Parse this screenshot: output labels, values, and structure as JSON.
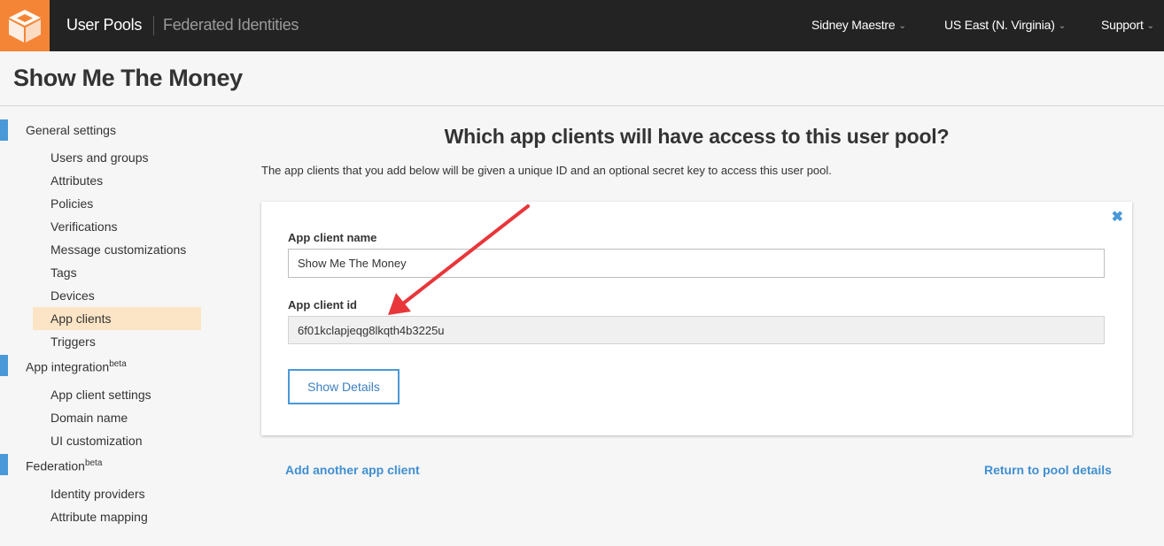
{
  "topnav": {
    "logo_icon": "cognito-cube-icon",
    "user_pools": "User Pools",
    "federated_identities": "Federated Identities",
    "user_menu": "Sidney Maestre",
    "region_menu": "US East (N. Virginia)",
    "support_menu": "Support"
  },
  "page": {
    "title": "Show Me The Money"
  },
  "sidebar": {
    "general_settings": "General settings",
    "general_items": [
      "Users and groups",
      "Attributes",
      "Policies",
      "Verifications",
      "Message customizations",
      "Tags",
      "Devices",
      "App clients",
      "Triggers"
    ],
    "active_item": "App clients",
    "app_integration": "App integration",
    "app_integration_badge": "beta",
    "app_integration_items": [
      "App client settings",
      "Domain name",
      "UI customization"
    ],
    "federation": "Federation",
    "federation_badge": "beta",
    "federation_items": [
      "Identity providers",
      "Attribute mapping"
    ]
  },
  "main": {
    "heading": "Which app clients will have access to this user pool?",
    "description": "The app clients that you add below will be given a unique ID and an optional secret key to access this user pool.",
    "card": {
      "name_label": "App client name",
      "name_value": "Show Me The Money",
      "id_label": "App client id",
      "id_value": "6f01kclapjeqg8lkqth4b3225u",
      "show_details": "Show Details",
      "close_icon": "close-icon"
    },
    "add_another": "Add another app client",
    "return_link": "Return to pool details"
  },
  "colors": {
    "nav_bg": "#232323",
    "brand_orange": "#f58536",
    "accent_blue": "#4a98d8",
    "active_bg": "#fbe5c6",
    "annotation_red": "#e8363a"
  }
}
